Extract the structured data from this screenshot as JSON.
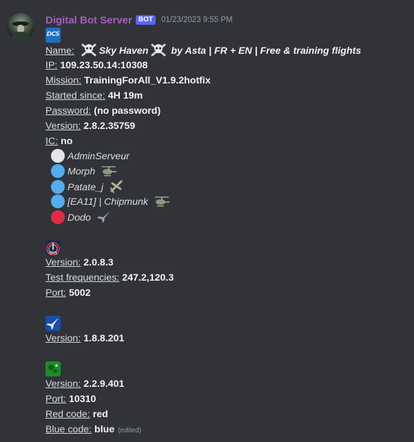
{
  "message": {
    "author": "Digital Bot Server",
    "badge": "BOT",
    "timestamp": "01/23/2023 9:55 PM",
    "edited_label": "(edited)"
  },
  "dcs": {
    "name_label": "Name:",
    "name_value": "Sky Haven",
    "name_suffix": "by Asta | FR + EN | Free & training flights",
    "ip_label": "IP:",
    "ip_value": "109.23.50.14:10308",
    "mission_label": "Mission:",
    "mission_value": "TrainingForAll_V1.9.2hotfix",
    "started_label": "Started since:",
    "started_value": "4H 19m",
    "password_label": "Password:",
    "password_value": "(no password)",
    "version_label": "Version:",
    "version_value": "2.8.2.35759",
    "ic_label": "IC:",
    "ic_value": "no",
    "icon_text": "DCS",
    "players": [
      {
        "name": "AdminServeur",
        "color": "#e3e5e8"
      },
      {
        "name": "Morph",
        "color": "#55acee"
      },
      {
        "name": "Patate_j",
        "color": "#55acee"
      },
      {
        "name": "[EA11] | Chipmunk",
        "color": "#55acee"
      },
      {
        "name": "Dodo",
        "color": "#dd2e44"
      }
    ]
  },
  "srs": {
    "version_label": "Version:",
    "version_value": "2.0.8.3",
    "freq_label": "Test frequencies:",
    "freq_value": "247.2,120.3",
    "port_label": "Port:",
    "port_value": "5002"
  },
  "tacview": {
    "version_label": "Version:",
    "version_value": "1.8.8.201"
  },
  "lotatc": {
    "version_label": "Version:",
    "version_value": "2.2.9.401",
    "port_label": "Port:",
    "port_value": "10310",
    "red_label": "Red code:",
    "red_value": "red",
    "blue_label": "Blue code:",
    "blue_value": "blue"
  }
}
